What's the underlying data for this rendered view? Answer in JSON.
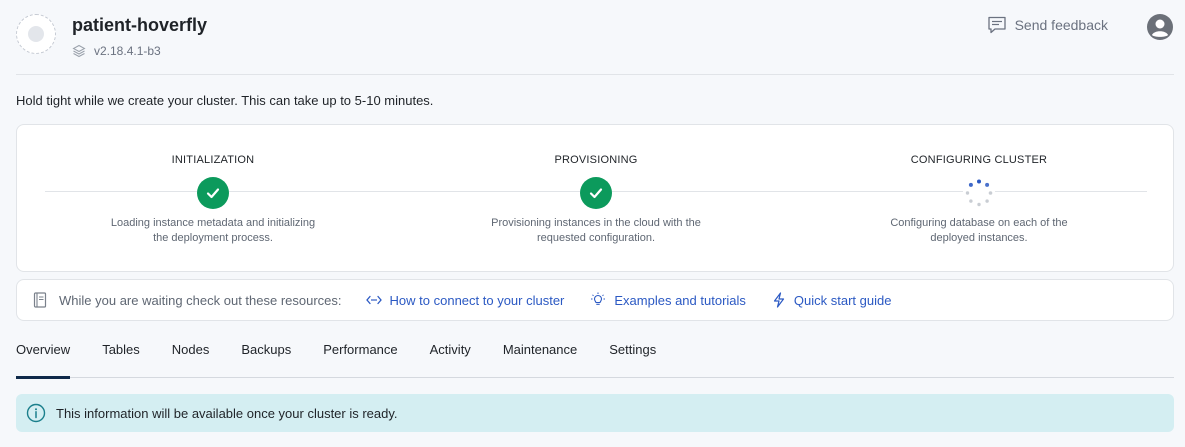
{
  "header": {
    "cluster_name": "patient-hoverfly",
    "version": "v2.18.4.1-b3",
    "feedback_label": "Send feedback"
  },
  "notice": "Hold tight while we create your cluster. This can take up to 5-10 minutes.",
  "steps": [
    {
      "title": "INITIALIZATION",
      "desc_line1": "Loading instance metadata and initializing",
      "desc_line2": "the deployment process.",
      "status": "done"
    },
    {
      "title": "PROVISIONING",
      "desc_line1": "Provisioning instances in the cloud with the",
      "desc_line2": "requested configuration.",
      "status": "done"
    },
    {
      "title": "CONFIGURING CLUSTER",
      "desc_line1": "Configuring database on each of the",
      "desc_line2": "deployed instances.",
      "status": "in-progress"
    }
  ],
  "resources": {
    "lead": "While you are waiting check out these resources:",
    "links": [
      {
        "label": "How to connect to your cluster",
        "icon": "connect-icon"
      },
      {
        "label": "Examples and tutorials",
        "icon": "lightbulb-icon"
      },
      {
        "label": "Quick start guide",
        "icon": "lightning-icon"
      }
    ]
  },
  "tabs": [
    "Overview",
    "Tables",
    "Nodes",
    "Backups",
    "Performance",
    "Activity",
    "Maintenance",
    "Settings"
  ],
  "active_tab": "Overview",
  "info_banner": "This information will be available once your cluster is ready.",
  "colors": {
    "success": "#0c9a5c",
    "link": "#2b59c3",
    "info_bg": "#d4eef2",
    "tab_active": "#0f2a4a"
  }
}
